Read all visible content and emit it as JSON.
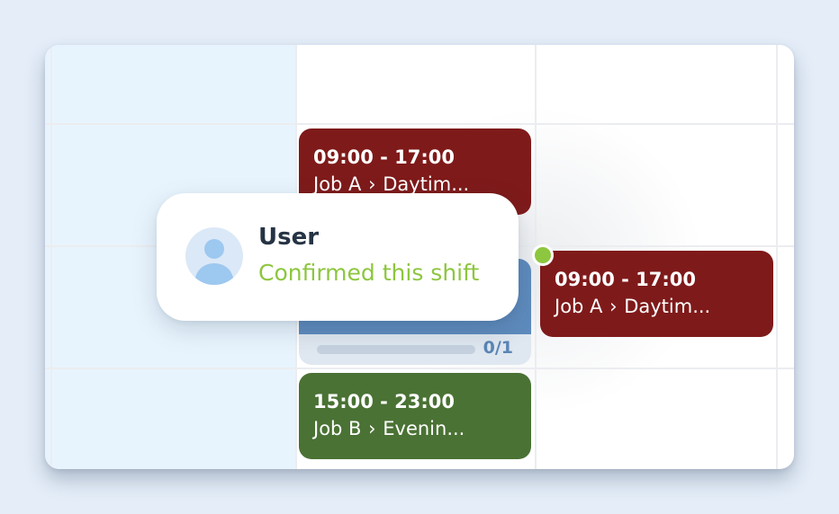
{
  "shifts": [
    {
      "time": "09:00 - 17:00",
      "job": "Job A",
      "separator": "›",
      "role": "Daytim...",
      "color": "#7f1a1a"
    },
    {
      "time": "09:00 - 17:00",
      "job": "Job A",
      "separator": "›",
      "role": "Daytim...",
      "color": "#7f1a1a"
    },
    {
      "time": "15:00 - 23:00",
      "job": "Job B",
      "separator": "›",
      "role": "Evenin...",
      "color": "#4a7234"
    }
  ],
  "open_shift": {
    "color": "#5e8bbd",
    "filled": 0,
    "required": 1,
    "count_label": "0/1"
  },
  "tooltip": {
    "name": "User",
    "status": "Confirmed this shift",
    "status_color": "#8dc63f",
    "avatar_icon": "user-avatar-icon"
  },
  "colors": {
    "background": "#e4edf8",
    "highlight_column": "#e8f4fd",
    "confirm_dot": "#8dc63f"
  }
}
